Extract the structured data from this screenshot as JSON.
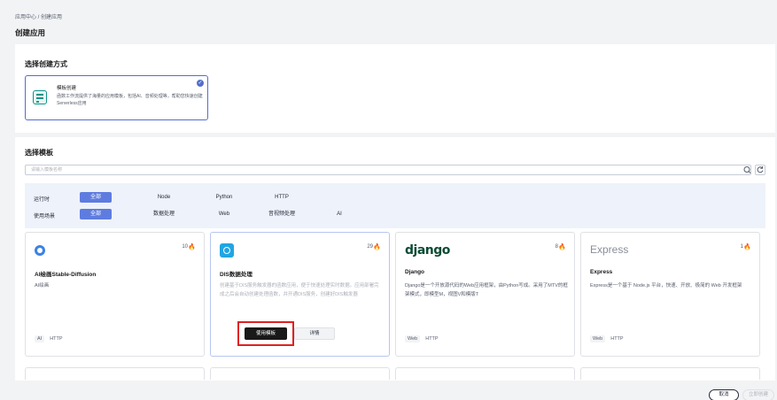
{
  "breadcrumb": "应用中心 / 创建应用",
  "page_title": "创建应用",
  "method_section": {
    "title": "选择创建方式",
    "card": {
      "name": "模板创建",
      "description": "函数工作流提供了海量的应用模板，包括AI、音频处理等，帮助您快速创建Serverless应用",
      "selected": true
    }
  },
  "template_section": {
    "title": "选择模板",
    "search_placeholder": "请输入模板名称",
    "filters": {
      "runtime_label": "运行时",
      "runtime_options": [
        "全部",
        "Node",
        "Python",
        "HTTP"
      ],
      "runtime_selected": "全部",
      "scene_label": "使用场景",
      "scene_options": [
        "全部",
        "数据处理",
        "Web",
        "音视频处理",
        "AI"
      ],
      "scene_selected": "全部"
    },
    "cards": [
      {
        "name": "AI绘画Stable-Diffusion",
        "count": "10",
        "description": "AI绘画",
        "tags": [
          "AI",
          "HTTP"
        ],
        "logo": "stable-diffusion-logo"
      },
      {
        "name": "DIS数据处理",
        "count": "29",
        "description": "创建基于DIS服务触发器的函数应用，便于快速处理实时数据。应用部署完成之后会自动创建处理函数，并开通DIS服务，创建好DIS触发器",
        "tags": [],
        "logo": "dis-logo",
        "use_label": "使用模板",
        "detail_label": "详情"
      },
      {
        "name": "Django",
        "count": "8",
        "description": "Django是一个开放源代码的Web应用框架，由Python写成。采用了MTV的框架模式，即模型M，视图V和模版T",
        "tags": [
          "Web",
          "HTTP"
        ],
        "logo_text": "django"
      },
      {
        "name": "Express",
        "count": "1",
        "description": "Express是一个基于 Node.js 平台，快速、开放、极简的 Web 开发框架",
        "tags": [
          "Web",
          "HTTP"
        ],
        "logo_text": "Express"
      }
    ]
  },
  "footer": {
    "cancel_label": "取消",
    "create_label": "立即创建"
  },
  "colors": {
    "accent": "#5e7ce0",
    "highlight": "#e02020",
    "fire": "#e8413c"
  }
}
